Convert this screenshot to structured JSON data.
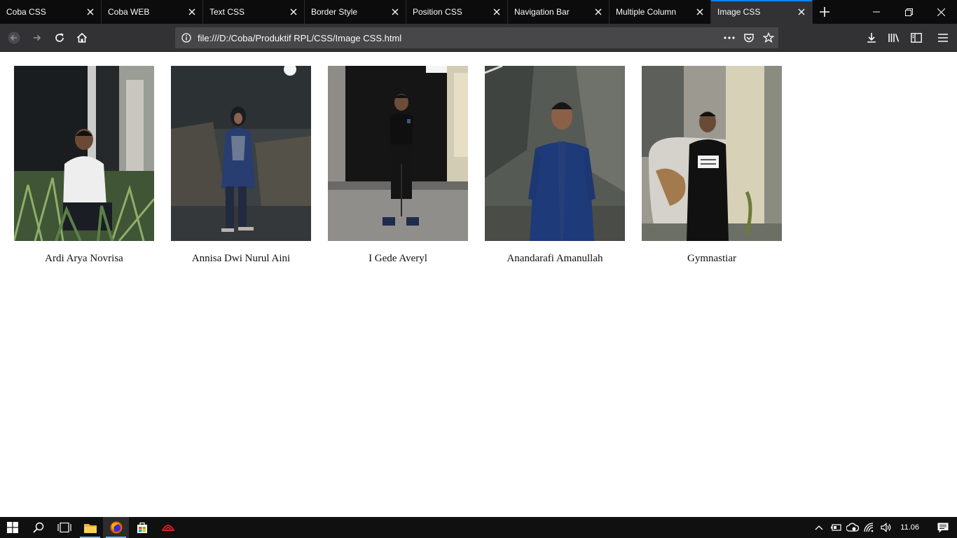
{
  "browser": {
    "tabs": [
      {
        "label": "Coba CSS",
        "active": false
      },
      {
        "label": "Coba WEB",
        "active": false
      },
      {
        "label": "Text CSS",
        "active": false
      },
      {
        "label": "Border Style",
        "active": false
      },
      {
        "label": "Position CSS",
        "active": false
      },
      {
        "label": "Navigation Bar",
        "active": false
      },
      {
        "label": "Multiple Column",
        "active": false
      },
      {
        "label": "Image CSS",
        "active": true
      }
    ],
    "url": "file:///D:/Coba/Produktif RPL/CSS/Image CSS.html",
    "accent_color": "#0a84ff"
  },
  "gallery": {
    "items": [
      {
        "name": "Ardi Arya Novrisa",
        "photo_icon": "person-photo"
      },
      {
        "name": "Annisa Dwi Nurul Aini",
        "photo_icon": "person-photo"
      },
      {
        "name": "I Gede Averyl",
        "photo_icon": "person-photo"
      },
      {
        "name": "Anandarafi Amanullah",
        "photo_icon": "person-photo"
      },
      {
        "name": "Gymnastiar",
        "photo_icon": "person-photo"
      }
    ]
  },
  "taskbar": {
    "clock": "11.06"
  }
}
